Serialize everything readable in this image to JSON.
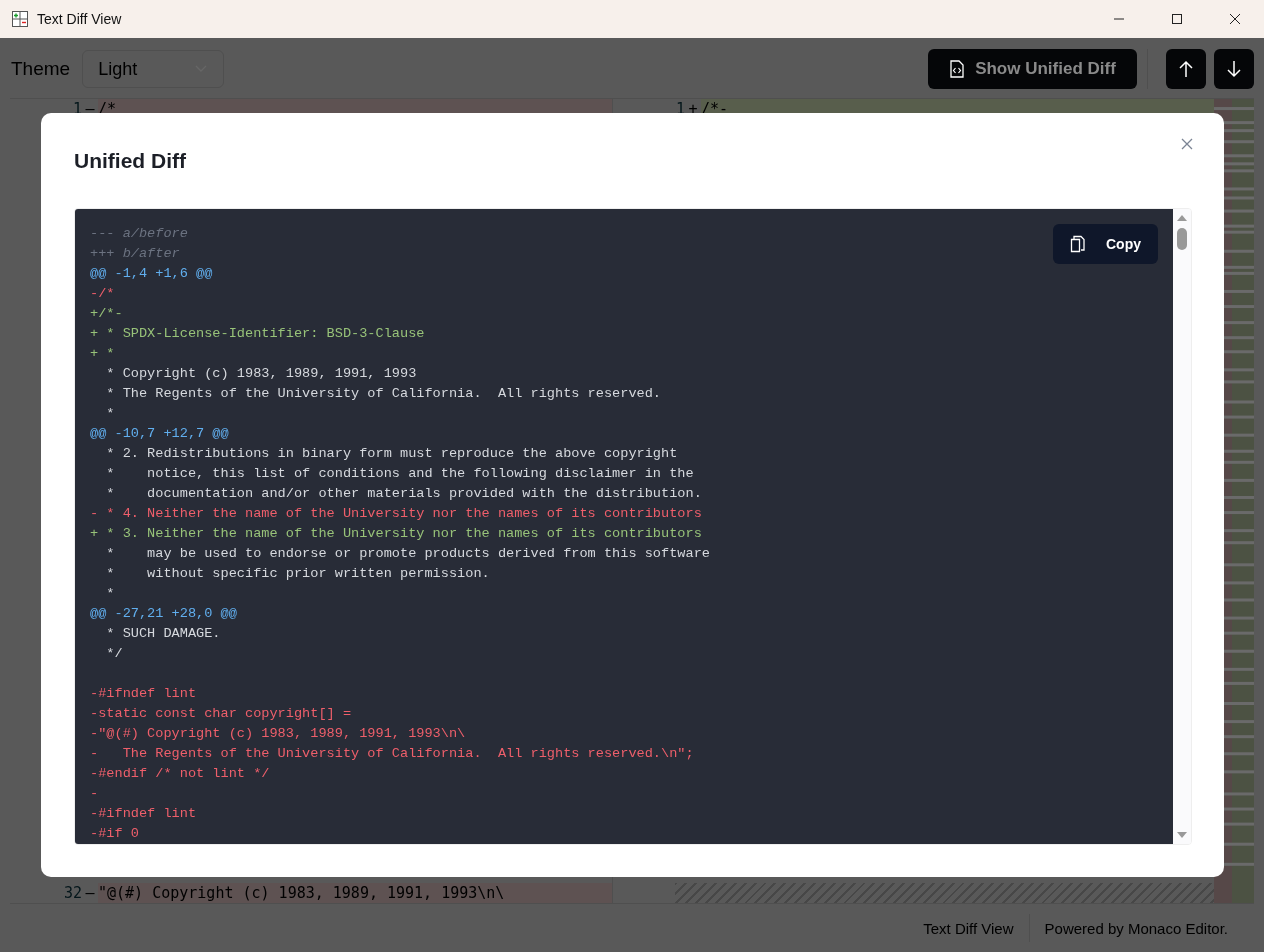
{
  "window": {
    "title": "Text Diff View"
  },
  "toolbar": {
    "theme_label": "Theme",
    "theme_value": "Light",
    "unified_button": "Show Unified Diff"
  },
  "editor": {
    "left_first": {
      "number": "1",
      "marker": "—",
      "text": "/*"
    },
    "left_last": {
      "number": "32",
      "marker": "—",
      "text": "\"@(#) Copyright (c) 1983, 1989, 1991, 1993\\n\\"
    },
    "right_first": {
      "number": "1",
      "marker": "+",
      "text": "/*-"
    }
  },
  "footer": {
    "app_name": "Text Diff View",
    "powered": "Powered by Monaco Editor."
  },
  "dialog": {
    "title": "Unified Diff",
    "copy_button": "Copy",
    "lines": [
      {
        "kind": "meta",
        "text": "--- a/before"
      },
      {
        "kind": "meta",
        "text": "+++ b/after"
      },
      {
        "kind": "hunk",
        "text": "@@ -1,4 +1,6 @@"
      },
      {
        "kind": "del",
        "text": "-/*"
      },
      {
        "kind": "add",
        "text": "+/*-"
      },
      {
        "kind": "add",
        "text": "+ * SPDX-License-Identifier: BSD-3-Clause"
      },
      {
        "kind": "add",
        "text": "+ *"
      },
      {
        "kind": "ctx",
        "text": "  * Copyright (c) 1983, 1989, 1991, 1993"
      },
      {
        "kind": "ctx",
        "text": "  * The Regents of the University of California.  All rights reserved."
      },
      {
        "kind": "ctx",
        "text": "  *"
      },
      {
        "kind": "hunk",
        "text": "@@ -10,7 +12,7 @@"
      },
      {
        "kind": "ctx",
        "text": "  * 2. Redistributions in binary form must reproduce the above copyright"
      },
      {
        "kind": "ctx",
        "text": "  *    notice, this list of conditions and the following disclaimer in the"
      },
      {
        "kind": "ctx",
        "text": "  *    documentation and/or other materials provided with the distribution."
      },
      {
        "kind": "del",
        "text": "- * 4. Neither the name of the University nor the names of its contributors"
      },
      {
        "kind": "add",
        "text": "+ * 3. Neither the name of the University nor the names of its contributors"
      },
      {
        "kind": "ctx",
        "text": "  *    may be used to endorse or promote products derived from this software"
      },
      {
        "kind": "ctx",
        "text": "  *    without specific prior written permission."
      },
      {
        "kind": "ctx",
        "text": "  *"
      },
      {
        "kind": "hunk",
        "text": "@@ -27,21 +28,0 @@"
      },
      {
        "kind": "ctx",
        "text": "  * SUCH DAMAGE."
      },
      {
        "kind": "ctx",
        "text": "  */"
      },
      {
        "kind": "blank"
      },
      {
        "kind": "del",
        "text": "-#ifndef lint"
      },
      {
        "kind": "del",
        "text": "-static const char copyright[] ="
      },
      {
        "kind": "del",
        "text": "-\"@(#) Copyright (c) 1983, 1989, 1991, 1993\\n\\"
      },
      {
        "kind": "del",
        "text": "-   The Regents of the University of California.  All rights reserved.\\n\";"
      },
      {
        "kind": "del",
        "text": "-#endif /* not lint */"
      },
      {
        "kind": "del",
        "text": "-"
      },
      {
        "kind": "del",
        "text": "-#ifndef lint"
      },
      {
        "kind": "del",
        "text": "-#if 0"
      }
    ]
  }
}
